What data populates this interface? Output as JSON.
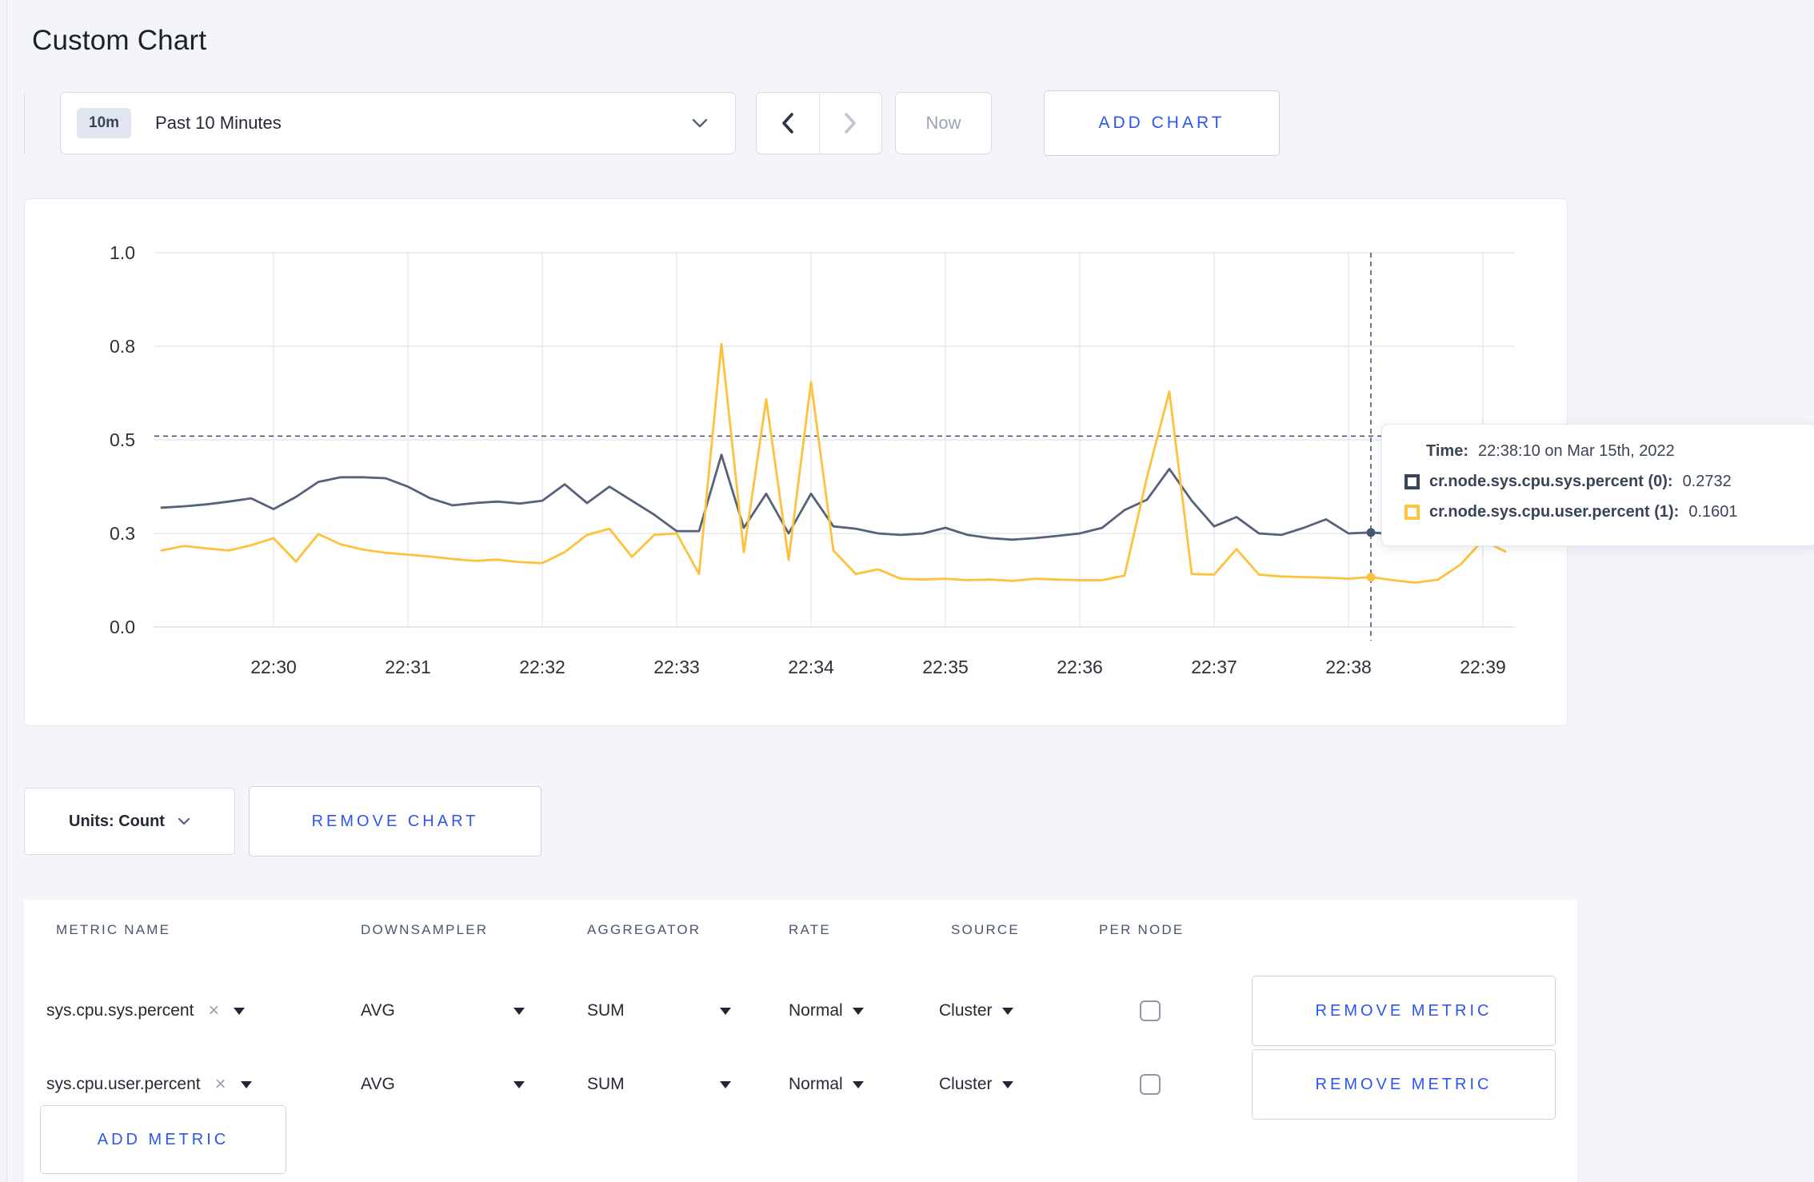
{
  "page": {
    "title": "Custom Chart"
  },
  "toolbar": {
    "time_range": {
      "badge": "10m",
      "label": "Past 10 Minutes"
    },
    "now_label": "Now",
    "add_chart_label": "ADD CHART"
  },
  "chart": {
    "tooltip": {
      "time_label": "Time:",
      "time_value": "22:38:10 on Mar 15th, 2022",
      "series": [
        {
          "label": "cr.node.sys.cpu.sys.percent (0):",
          "value": "0.2732",
          "color": "#394455"
        },
        {
          "label": "cr.node.sys.cpu.user.percent (1):",
          "value": "0.1601",
          "color": "#ffc53d"
        }
      ]
    }
  },
  "chart_data": {
    "type": "line",
    "title": "",
    "xlabel": "",
    "ylabel": "",
    "grid": true,
    "legend_position": "tooltip",
    "y_tick_labels": [
      "0.0",
      "0.3",
      "0.5",
      "0.8",
      "1.0"
    ],
    "y_tick_values": [
      0.0,
      0.3,
      0.5,
      0.8,
      1.0
    ],
    "x_ticks": [
      "22:30",
      "22:31",
      "22:32",
      "22:33",
      "22:34",
      "22:35",
      "22:36",
      "22:37",
      "22:38",
      "22:39"
    ],
    "x": [
      "22:29:10",
      "22:29:20",
      "22:29:30",
      "22:29:40",
      "22:29:50",
      "22:30:00",
      "22:30:10",
      "22:30:20",
      "22:30:30",
      "22:30:40",
      "22:30:50",
      "22:31:00",
      "22:31:10",
      "22:31:20",
      "22:31:30",
      "22:31:40",
      "22:31:50",
      "22:32:00",
      "22:32:10",
      "22:32:20",
      "22:32:30",
      "22:32:40",
      "22:32:50",
      "22:33:00",
      "22:33:10",
      "22:33:20",
      "22:33:30",
      "22:33:40",
      "22:33:50",
      "22:34:00",
      "22:34:10",
      "22:34:20",
      "22:34:30",
      "22:34:40",
      "22:34:50",
      "22:35:00",
      "22:35:10",
      "22:35:20",
      "22:35:30",
      "22:35:40",
      "22:35:50",
      "22:36:00",
      "22:36:10",
      "22:36:20",
      "22:36:30",
      "22:36:40",
      "22:36:50",
      "22:37:00",
      "22:37:10",
      "22:37:20",
      "22:37:30",
      "22:37:40",
      "22:37:50",
      "22:38:00",
      "22:38:10",
      "22:38:20",
      "22:38:30",
      "22:38:40",
      "22:38:50",
      "22:39:00",
      "22:39:10"
    ],
    "series": [
      {
        "name": "cr.node.sys.cpu.sys.percent",
        "color": "#56617c",
        "values": [
          0.355,
          0.358,
          0.362,
          0.368,
          0.375,
          0.352,
          0.378,
          0.41,
          0.42,
          0.42,
          0.418,
          0.4,
          0.375,
          0.36,
          0.365,
          0.368,
          0.364,
          0.37,
          0.405,
          0.365,
          0.4,
          0.37,
          0.34,
          0.305,
          0.305,
          0.468,
          0.312,
          0.385,
          0.3,
          0.385,
          0.315,
          0.31,
          0.3,
          0.295,
          0.3,
          0.312,
          0.295,
          0.285,
          0.28,
          0.285,
          0.292,
          0.3,
          0.312,
          0.35,
          0.372,
          0.438,
          0.37,
          0.315,
          0.335,
          0.3,
          0.295,
          0.312,
          0.33,
          0.3,
          0.302,
          0.298,
          0.31,
          0.3,
          0.295,
          0.3,
          0.308
        ]
      },
      {
        "name": "cr.node.sys.cpu.user.percent",
        "color": "#fdc13b",
        "values": [
          0.245,
          0.26,
          0.252,
          0.245,
          0.262,
          0.285,
          0.21,
          0.298,
          0.265,
          0.248,
          0.238,
          0.232,
          0.226,
          0.218,
          0.212,
          0.216,
          0.208,
          0.205,
          0.24,
          0.295,
          0.31,
          0.225,
          0.295,
          0.3,
          0.17,
          0.805,
          0.24,
          0.63,
          0.215,
          0.685,
          0.245,
          0.17,
          0.185,
          0.155,
          0.152,
          0.155,
          0.15,
          0.152,
          0.148,
          0.155,
          0.152,
          0.15,
          0.15,
          0.165,
          0.42,
          0.655,
          0.17,
          0.168,
          0.25,
          0.168,
          0.162,
          0.16,
          0.158,
          0.155,
          0.16,
          0.15,
          0.142,
          0.152,
          0.2,
          0.278,
          0.242
        ]
      }
    ],
    "crosshair": {
      "time": "22:38:10",
      "hline_value": 0.512,
      "points": [
        {
          "series": "cr.node.sys.cpu.sys.percent",
          "value": 0.302,
          "color": "#475872"
        },
        {
          "series": "cr.node.sys.cpu.user.percent",
          "value": 0.16,
          "color": "#fdc13b"
        }
      ]
    }
  },
  "units_row": {
    "units_label": "Units: Count",
    "remove_chart_label": "REMOVE CHART"
  },
  "metrics_table": {
    "headers": [
      "METRIC NAME",
      "DOWNSAMPLER",
      "AGGREGATOR",
      "RATE",
      "SOURCE",
      "PER NODE"
    ],
    "rows": [
      {
        "metric": "sys.cpu.sys.percent",
        "downsampler": "AVG",
        "aggregator": "SUM",
        "rate": "Normal",
        "source": "Cluster",
        "per_node": false,
        "remove_label": "REMOVE METRIC"
      },
      {
        "metric": "sys.cpu.user.percent",
        "downsampler": "AVG",
        "aggregator": "SUM",
        "rate": "Normal",
        "source": "Cluster",
        "per_node": false,
        "remove_label": "REMOVE METRIC"
      }
    ],
    "add_metric_label": "ADD METRIC"
  },
  "colors": {
    "accent_blue": "#2b55f0",
    "series_sys": "#56617c",
    "series_user": "#fdc13b",
    "page_bg": "#f4f5f9",
    "grid": "#e7e9ee"
  }
}
